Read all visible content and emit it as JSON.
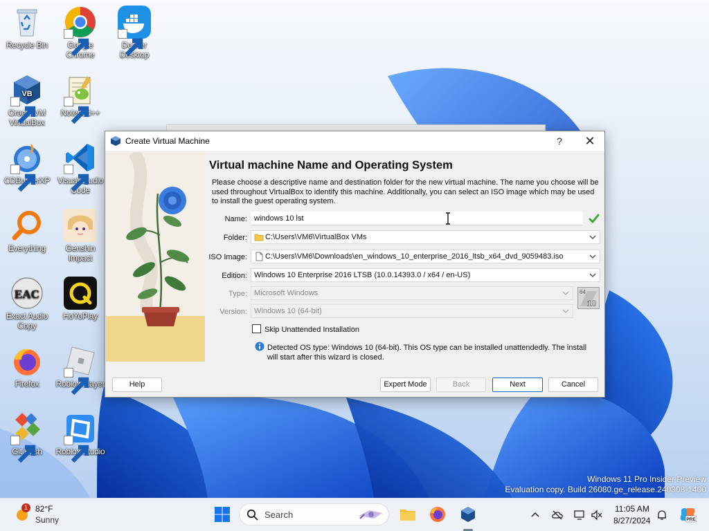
{
  "desktop": {
    "icons": [
      {
        "label": "Recycle Bin"
      },
      {
        "label": "Google Chrome"
      },
      {
        "label": "Docker Desktop"
      },
      {
        "label": "Oracle VM VirtualBox"
      },
      {
        "label": "Notepad++"
      },
      {
        "label": "CDBurnerXP"
      },
      {
        "label": "Visual Studio Code"
      },
      {
        "label": "Everything"
      },
      {
        "label": "Genshin Impact"
      },
      {
        "label": "Exact Audio Copy"
      },
      {
        "label": "HoYoPlay"
      },
      {
        "label": "Firefox"
      },
      {
        "label": "Roblox Player"
      },
      {
        "label": "Git Bash"
      },
      {
        "label": "Roblox Studio"
      }
    ],
    "watermark": {
      "line1": "Windows 11 Pro Insider Preview",
      "line2": "Evaluation copy. Build 26080.ge_release.240308-1400"
    }
  },
  "dialog": {
    "title": "Create Virtual Machine",
    "help_glyph": "?",
    "close_glyph": "✕",
    "heading": "Virtual machine Name and Operating System",
    "description": "Please choose a descriptive name and destination folder for the new virtual machine. The name you choose will be used throughout VirtualBox to identify this machine. Additionally, you can select an ISO image which may be used to install the guest operating system.",
    "fields": {
      "name": {
        "label": "Name:",
        "value": "windows 10 lst"
      },
      "folder": {
        "label": "Folder:",
        "value": "C:\\Users\\VM6\\VirtualBox VMs"
      },
      "iso": {
        "label": "ISO Image:",
        "value": "C:\\Users\\VM6\\Downloads\\en_windows_10_enterprise_2016_ltsb_x64_dvd_9059483.iso"
      },
      "edition": {
        "label": "Edition:",
        "value": "Windows 10 Enterprise 2016 LTSB (10.0.14393.0 / x64 / en-US)"
      },
      "type": {
        "label": "Type:",
        "value": "Microsoft Windows"
      },
      "version": {
        "label": "Version:",
        "value": "Windows 10 (64-bit)"
      }
    },
    "os_badge": {
      "top": "64",
      "bottom": "10"
    },
    "skip_unattended": {
      "label": "Skip Unattended Installation",
      "checked": false
    },
    "info": "Detected OS type: Windows 10 (64-bit). This OS type can be installed unattendedly. The install will start after this wizard is closed.",
    "buttons": {
      "help": "Help",
      "expert": "Expert Mode",
      "back": "Back",
      "next": "Next",
      "cancel": "Cancel"
    }
  },
  "taskbar": {
    "weather": {
      "temp": "82°F",
      "condition": "Sunny",
      "badge": "1"
    },
    "search_label": "Search",
    "clock": {
      "time": "11:05 AM",
      "date": "8/27/2024"
    },
    "copilot_badge": "PRE"
  },
  "colors": {
    "accent": "#0067c0",
    "check_green": "#3aa838",
    "wallpaper_blue": "#1e5fd6"
  }
}
